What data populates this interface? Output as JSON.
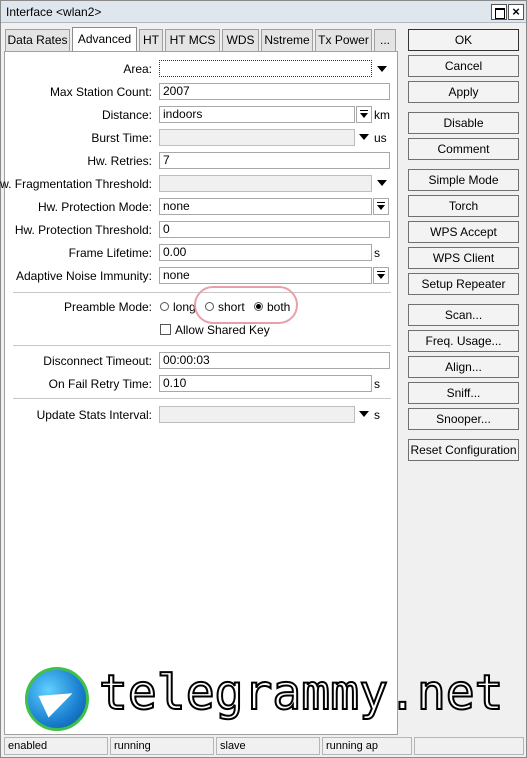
{
  "window": {
    "title": "Interface <wlan2>"
  },
  "tabs": [
    {
      "label": "Data Rates"
    },
    {
      "label": "Advanced"
    },
    {
      "label": "HT"
    },
    {
      "label": "HT MCS"
    },
    {
      "label": "WDS"
    },
    {
      "label": "Nstreme"
    },
    {
      "label": "Tx Power"
    },
    {
      "label": "..."
    }
  ],
  "fields": {
    "area": {
      "label": "Area:",
      "value": ""
    },
    "max_station_count": {
      "label": "Max Station Count:",
      "value": "2007"
    },
    "distance": {
      "label": "Distance:",
      "value": "indoors",
      "unit": "km"
    },
    "burst_time": {
      "label": "Burst Time:",
      "value": "",
      "unit": "us"
    },
    "hw_retries": {
      "label": "Hw. Retries:",
      "value": "7"
    },
    "hw_frag": {
      "label": "Hw. Fragmentation Threshold:",
      "value": ""
    },
    "hw_protection_mode": {
      "label": "Hw. Protection Mode:",
      "value": "none"
    },
    "hw_protection_threshold": {
      "label": "Hw. Protection Threshold:",
      "value": "0"
    },
    "frame_lifetime": {
      "label": "Frame Lifetime:",
      "value": "0.00",
      "unit": "s"
    },
    "adaptive_noise": {
      "label": "Adaptive Noise Immunity:",
      "value": "none"
    },
    "preamble": {
      "label": "Preamble Mode:",
      "options": [
        "long",
        "short",
        "both"
      ],
      "selected": "both"
    },
    "allow_shared_key": {
      "label": "Allow Shared Key",
      "checked": false
    },
    "disconnect_timeout": {
      "label": "Disconnect Timeout:",
      "value": "00:00:03"
    },
    "on_fail_retry": {
      "label": "On Fail Retry Time:",
      "value": "0.10",
      "unit": "s"
    },
    "update_stats": {
      "label": "Update Stats Interval:",
      "value": "",
      "unit": "s"
    }
  },
  "buttons": {
    "ok": "OK",
    "cancel": "Cancel",
    "apply": "Apply",
    "disable": "Disable",
    "comment": "Comment",
    "simple_mode": "Simple Mode",
    "torch": "Torch",
    "wps_accept": "WPS Accept",
    "wps_client": "WPS Client",
    "setup_repeater": "Setup Repeater",
    "scan": "Scan...",
    "freq_usage": "Freq. Usage...",
    "align": "Align...",
    "sniff": "Sniff...",
    "snooper": "Snooper...",
    "reset_config": "Reset Configuration"
  },
  "status": [
    "enabled",
    "running",
    "slave",
    "running ap",
    ""
  ],
  "watermark": {
    "text": "telegrammy.net"
  },
  "colors": {
    "highlight_oval": "#e8a0a8",
    "logo_ring": "#3fc04a",
    "logo_fill": "#1a7fd0"
  }
}
